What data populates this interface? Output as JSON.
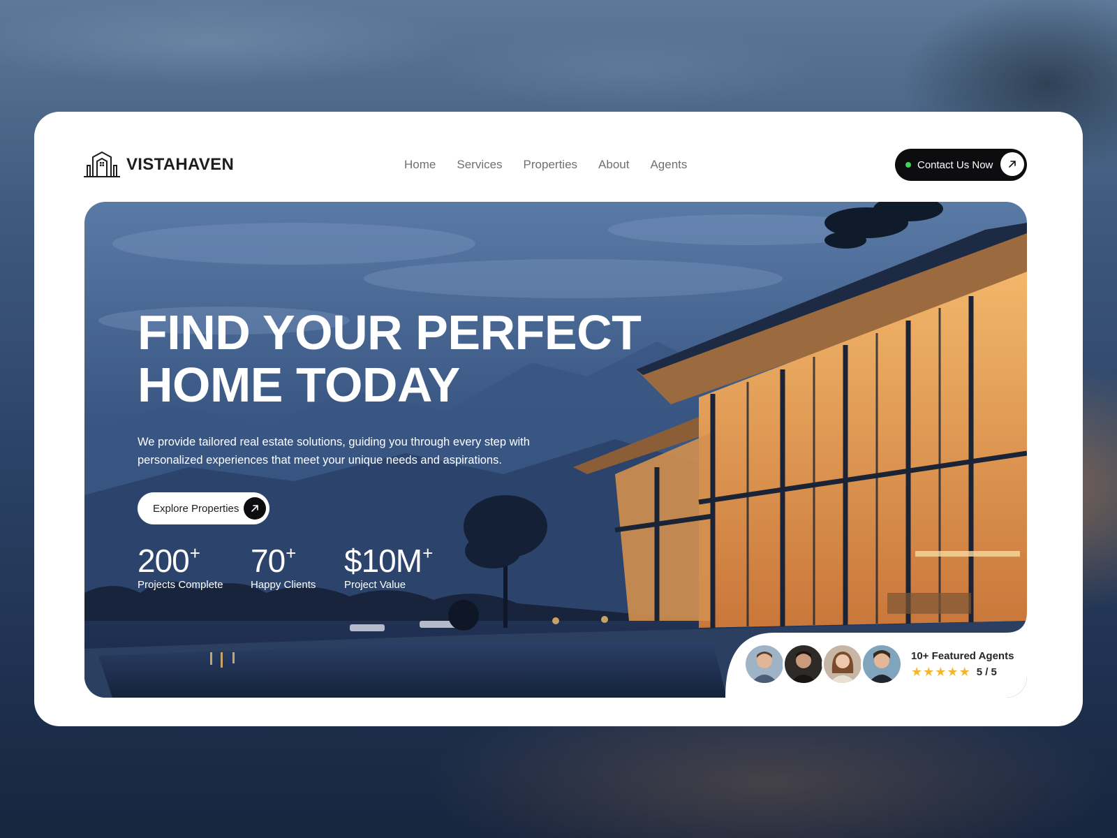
{
  "brand": {
    "name": "VISTAHAVEN",
    "logo_icon": "house-lines-logo-icon"
  },
  "nav": {
    "items": [
      {
        "label": "Home"
      },
      {
        "label": "Services"
      },
      {
        "label": "Properties"
      },
      {
        "label": "About"
      },
      {
        "label": "Agents"
      }
    ]
  },
  "header": {
    "contact_label": "Contact Us Now",
    "status_dot_color": "#3ed35a",
    "contact_icon": "arrow-up-right-icon"
  },
  "hero": {
    "headline_line1": "FIND YOUR PERFECT",
    "headline_line2": "HOME TODAY",
    "subtext": "We provide tailored real estate solutions, guiding you through every step with personalized experiences that meet your unique needs and aspirations.",
    "cta_label": "Explore Properties",
    "cta_icon": "arrow-up-right-icon"
  },
  "stats": [
    {
      "value": "200",
      "suffix": "+",
      "label": "Projects Complete"
    },
    {
      "value": "70",
      "suffix": "+",
      "label": "Happy Clients"
    },
    {
      "value": "$10M",
      "suffix": "+",
      "label": "Project Value"
    }
  ],
  "agents": {
    "title": "10+ Featured Agents",
    "stars": [
      "★",
      "★",
      "★",
      "★",
      "★"
    ],
    "rating": "5 / 5",
    "star_color": "#f2b630"
  },
  "colors": {
    "accent_dark": "#0d0d0f",
    "hero_sky": "#4a6894",
    "window_glow": "#e8a04c"
  }
}
